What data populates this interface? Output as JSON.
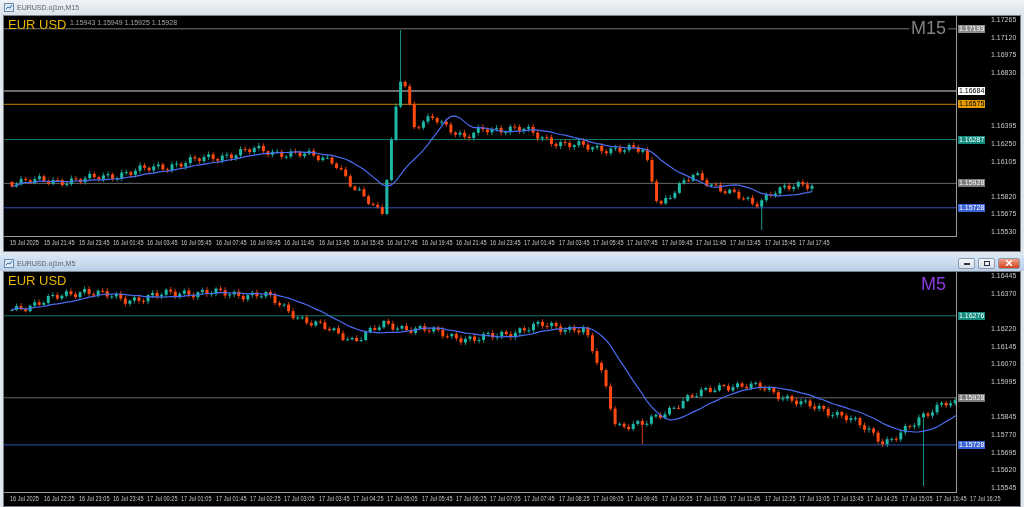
{
  "windows": [
    {
      "title": "EURUSD.oj1m,M15",
      "active": false,
      "symbol": "EUR USD",
      "ohlc": "1.15943 1.15949 1.15925 1.15928",
      "timeframe": "M15",
      "color": "#808080",
      "price_ticks": [
        "1.17265",
        "1.17120",
        "1.16975",
        "1.16830",
        "1.16395",
        "1.16250",
        "1.16105",
        "1.15820",
        "1.15675",
        "1.15530"
      ],
      "price_lines": [
        {
          "price": "1.17193",
          "color": "#8c8c8c"
        },
        {
          "price": "1.16684",
          "color": "#ffffff"
        },
        {
          "price": "1.16575",
          "color": "#e69b00"
        },
        {
          "price": "1.16287",
          "color": "#138a7e"
        },
        {
          "price": "1.15928",
          "color": "#7a7a7a"
        },
        {
          "price": "1.15728",
          "color": "#3b63d6"
        }
      ],
      "time_labels": [
        "15 Jul 2025",
        "15 Jul 21:45",
        "15 Jul 23:45",
        "16 Jul 01:45",
        "16 Jul 03:45",
        "16 Jul 05:45",
        "16 Jul 07:45",
        "16 Jul 09:45",
        "16 Jul 11:45",
        "16 Jul 13:45",
        "16 Jul 15:45",
        "16 Jul 17:45",
        "16 Jul 19:45",
        "16 Jul 21:45",
        "16 Jul 23:45",
        "17 Jul 01:45",
        "17 Jul 03:45",
        "17 Jul 05:45",
        "17 Jul 07:45",
        "17 Jul 09:45",
        "17 Jul 11:45",
        "17 Jul 13:45",
        "17 Jul 15:45",
        "17 Jul 17:45"
      ]
    },
    {
      "title": "EURUSD.oj1m,M5",
      "active": true,
      "symbol": "EUR USD",
      "timeframe": "M5",
      "color": "#8a3ce0",
      "price_ticks": [
        "1.16445",
        "1.16370",
        "1.16220",
        "1.16145",
        "1.16070",
        "1.15995",
        "1.15845",
        "1.15770",
        "1.15695",
        "1.15620",
        "1.15545"
      ],
      "price_lines": [
        {
          "price": "1.16276",
          "color": "#138a7e"
        },
        {
          "price": "1.15928",
          "color": "#7a7a7a"
        },
        {
          "price": "1.15728",
          "color": "#3b63d6"
        }
      ],
      "time_labels": [
        "16 Jul 2025",
        "16 Jul 22:25",
        "16 Jul 23:05",
        "16 Jul 23:45",
        "17 Jul 00:25",
        "17 Jul 01:05",
        "17 Jul 01:45",
        "17 Jul 02:25",
        "17 Jul 03:05",
        "17 Jul 03:45",
        "17 Jul 04:25",
        "17 Jul 05:05",
        "17 Jul 05:45",
        "17 Jul 06:25",
        "17 Jul 07:05",
        "17 Jul 07:45",
        "17 Jul 08:25",
        "17 Jul 09:05",
        "17 Jul 09:45",
        "17 Jul 10:25",
        "17 Jul 11:05",
        "17 Jul 11:45",
        "17 Jul 12:25",
        "17 Jul 13:05",
        "17 Jul 13:45",
        "17 Jul 14:25",
        "17 Jul 15:05",
        "17 Jul 15:45",
        "17 Jul 16:25"
      ]
    }
  ]
}
